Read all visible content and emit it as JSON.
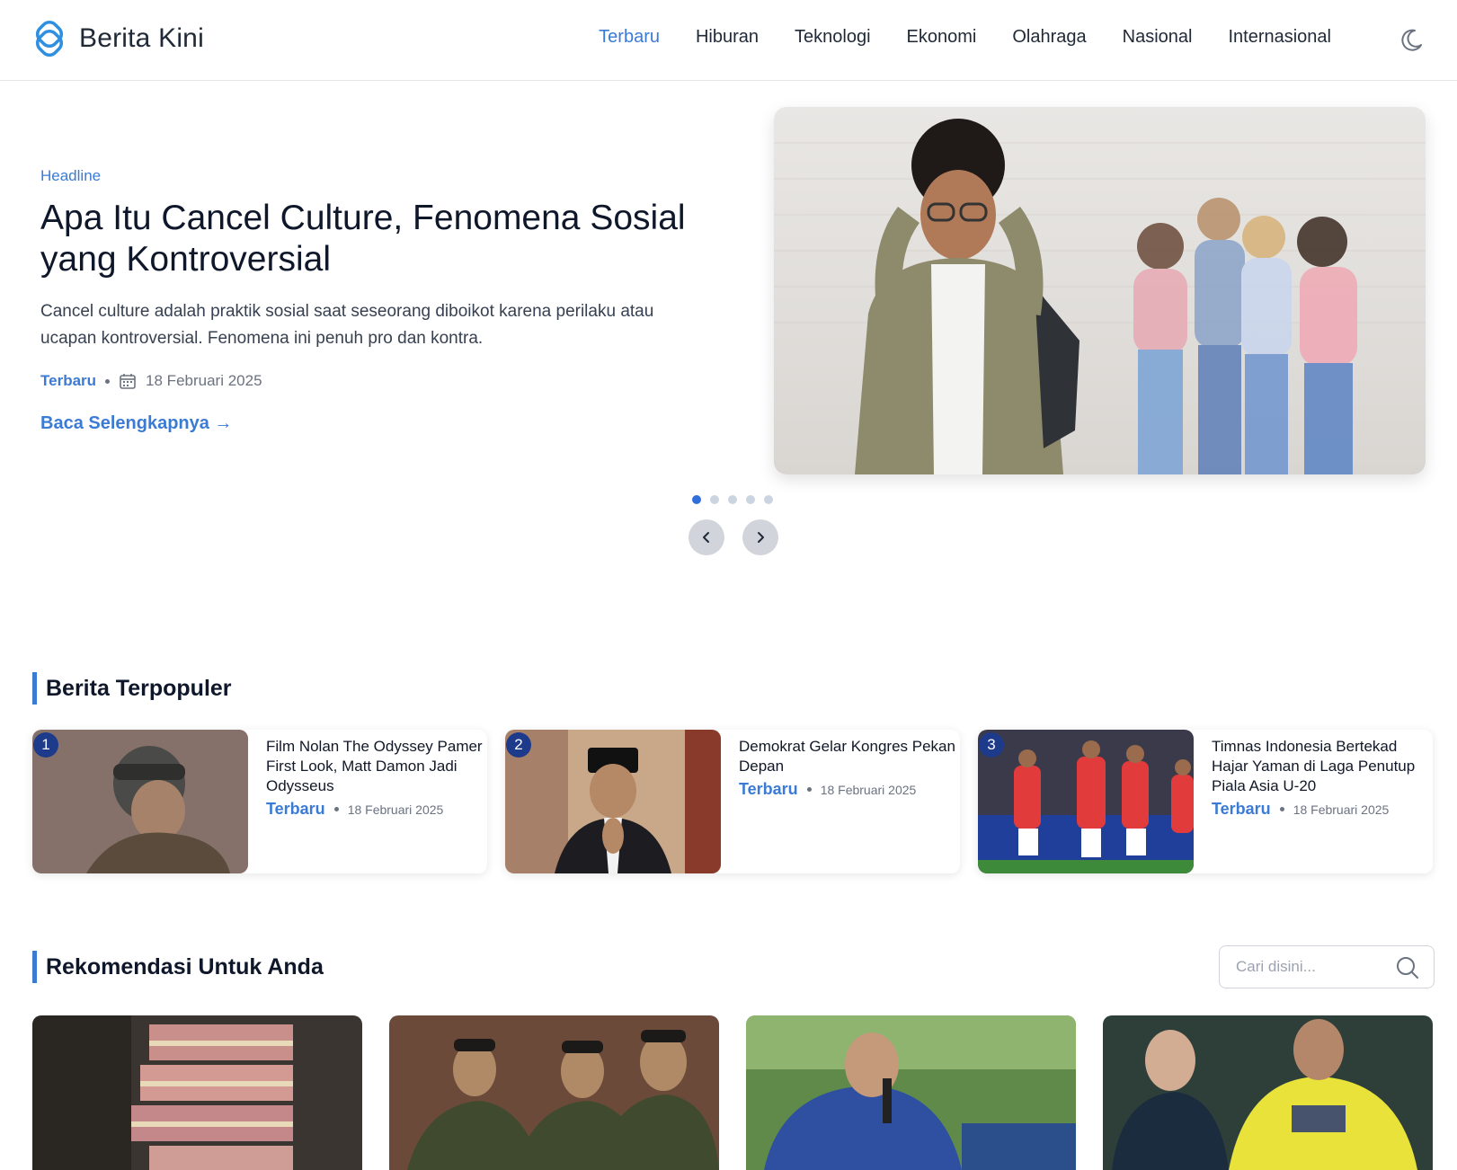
{
  "brand": {
    "name": "Berita Kini",
    "accent": "#3b7bd4"
  },
  "nav": {
    "items": [
      {
        "label": "Terbaru",
        "active": true
      },
      {
        "label": "Hiburan",
        "active": false
      },
      {
        "label": "Teknologi",
        "active": false
      },
      {
        "label": "Ekonomi",
        "active": false
      },
      {
        "label": "Olahraga",
        "active": false
      },
      {
        "label": "Nasional",
        "active": false
      },
      {
        "label": "Internasional",
        "active": false
      }
    ],
    "theme_icon": "moon-icon"
  },
  "hero": {
    "eyebrow": "Headline",
    "title": "Apa Itu Cancel Culture, Fenomena Sosial yang Kontroversial",
    "description": "Cancel culture adalah praktik sosial saat seseorang diboikot karena perilaku atau ucapan kontroversial. Fenomena ini penuh pro dan kontra.",
    "category": "Terbaru",
    "date": "18 Februari 2025",
    "read_more": "Baca Selengkapnya →",
    "slide_count": 5,
    "active_slide": 1
  },
  "popular": {
    "title": "Berita Terpopuler",
    "items": [
      {
        "rank": "1",
        "title": "Film Nolan The Odyssey Pamer First Look, Matt Damon Jadi Odysseus",
        "category": "Terbaru",
        "date": "18 Februari 2025"
      },
      {
        "rank": "2",
        "title": "Demokrat Gelar Kongres Pekan Depan",
        "category": "Terbaru",
        "date": "18 Februari 2025"
      },
      {
        "rank": "3",
        "title": "Timnas Indonesia Bertekad Hajar Yaman di Laga Penutup Piala Asia U-20",
        "category": "Terbaru",
        "date": "18 Februari 2025"
      }
    ]
  },
  "recommend": {
    "title": "Rekomendasi Untuk Anda",
    "search_placeholder": "Cari disini..."
  }
}
